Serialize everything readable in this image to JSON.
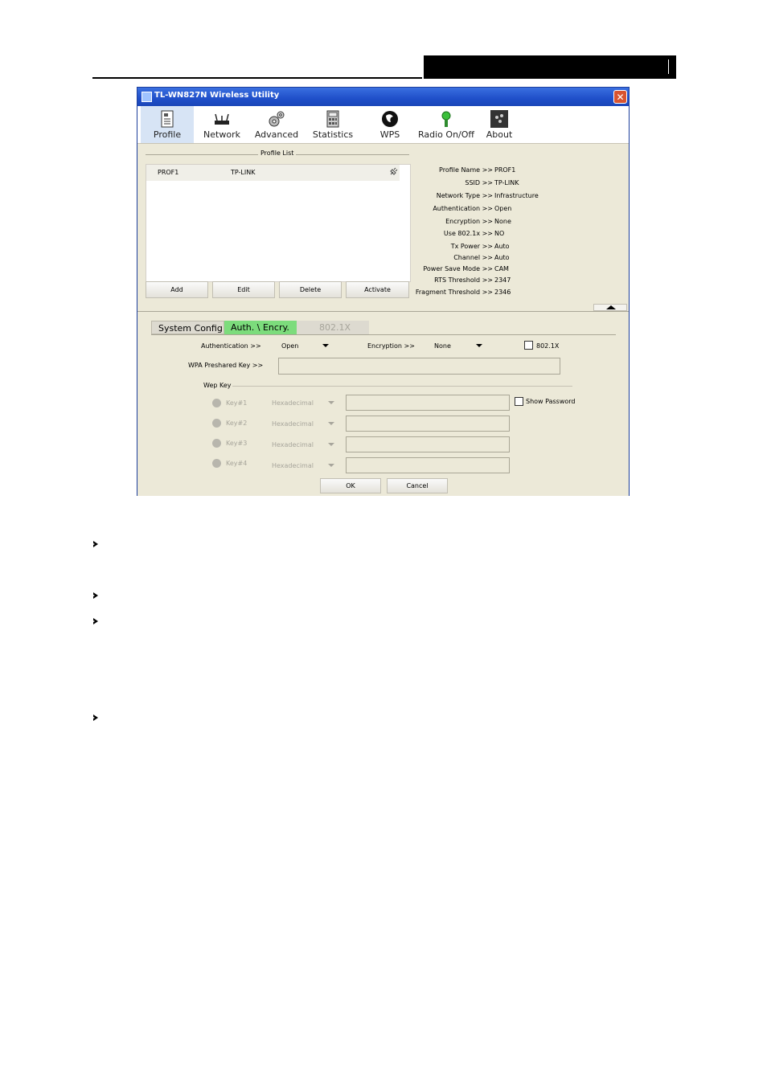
{
  "window": {
    "title": "TL-WN827N Wireless Utility",
    "close_glyph": "✕"
  },
  "toolbar": {
    "items": [
      {
        "label": "Profile",
        "icon": "profile-icon",
        "selected": true
      },
      {
        "label": "Network",
        "icon": "network-icon"
      },
      {
        "label": "Advanced",
        "icon": "advanced-icon"
      },
      {
        "label": "Statistics",
        "icon": "statistics-icon"
      },
      {
        "label": "WPS",
        "icon": "wps-icon"
      },
      {
        "label": "Radio On/Off",
        "icon": "radio-icon"
      },
      {
        "label": "About",
        "icon": "about-icon"
      }
    ]
  },
  "profile_list": {
    "title": "Profile List",
    "rows": [
      {
        "name": "PROF1",
        "ssid": "TP-LINK"
      }
    ],
    "buttons": {
      "add": "Add",
      "edit": "Edit",
      "delete": "Delete",
      "activate": "Activate"
    }
  },
  "profile_info": [
    {
      "key": "Profile Name >>",
      "value": "PROF1"
    },
    {
      "key": "SSID >>",
      "value": "TP-LINK"
    },
    {
      "key": "Network Type >>",
      "value": "Infrastructure"
    },
    {
      "key": "Authentication >>",
      "value": "Open"
    },
    {
      "key": "Encryption >>",
      "value": "None"
    },
    {
      "key": "Use 802.1x >>",
      "value": "NO"
    },
    {
      "key": "Tx Power >>",
      "value": "Auto"
    },
    {
      "key": "Channel >>",
      "value": "Auto"
    },
    {
      "key": "Power Save Mode >>",
      "value": "CAM"
    },
    {
      "key": "RTS Threshold >>",
      "value": "2347"
    },
    {
      "key": "Fragment Threshold >>",
      "value": "2346"
    }
  ],
  "tabs": [
    {
      "label": "System Config",
      "state": "normal"
    },
    {
      "label": "Auth. \\ Encry.",
      "state": "active"
    },
    {
      "label": "802.1X",
      "state": "disabled"
    }
  ],
  "auth": {
    "authentication_label": "Authentication >>",
    "authentication_value": "Open",
    "encryption_label": "Encryption >>",
    "encryption_value": "None",
    "dot1x_label": "802.1X",
    "wpa_label": "WPA Preshared Key >>",
    "wpa_value": "",
    "wep_title": "Wep Key",
    "keys": [
      {
        "label": "Key#1",
        "format": "Hexadecimal"
      },
      {
        "label": "Key#2",
        "format": "Hexadecimal"
      },
      {
        "label": "Key#3",
        "format": "Hexadecimal"
      },
      {
        "label": "Key#4",
        "format": "Hexadecimal"
      }
    ],
    "show_password_label": "Show Password",
    "ok_label": "OK",
    "cancel_label": "Cancel"
  },
  "colors": {
    "titlebar": "#1f4fc9",
    "active_tab": "#7cdc7c",
    "window_bg": "#ece9d8"
  }
}
